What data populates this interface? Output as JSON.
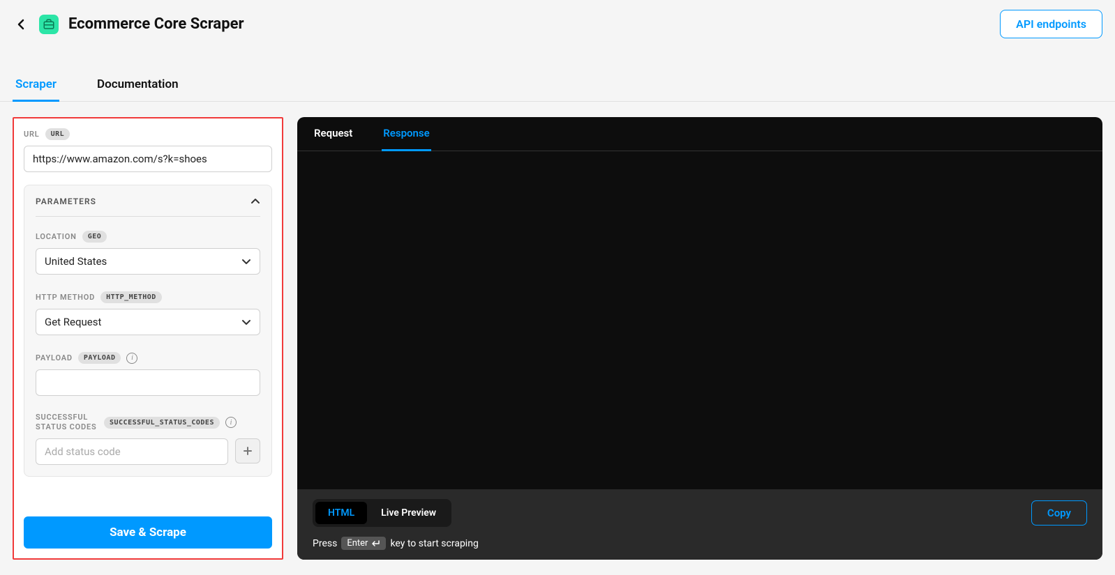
{
  "header": {
    "title": "Ecommerce Core Scraper",
    "api_endpoints": "API endpoints"
  },
  "tabs": {
    "scraper": "Scraper",
    "documentation": "Documentation"
  },
  "form": {
    "url": {
      "label": "URL",
      "badge": "URL",
      "value": "https://www.amazon.com/s?k=shoes"
    },
    "parameters_title": "PARAMETERS",
    "location": {
      "label": "LOCATION",
      "badge": "GEO",
      "value": "United States"
    },
    "http_method": {
      "label": "HTTP METHOD",
      "badge": "HTTP_METHOD",
      "value": "Get Request"
    },
    "payload": {
      "label": "PAYLOAD",
      "badge": "PAYLOAD",
      "value": ""
    },
    "status_codes": {
      "label": "SUCCESSFUL STATUS CODES",
      "badge": "SUCCESSFUL_STATUS_CODES",
      "placeholder": "Add status code"
    },
    "save_scrape": "Save & Scrape"
  },
  "right": {
    "tabs": {
      "request": "Request",
      "response": "Response"
    },
    "view": {
      "html": "HTML",
      "live": "Live Preview"
    },
    "copy": "Copy",
    "hint_press": "Press",
    "hint_enter": "Enter",
    "hint_rest": "key to start scraping"
  }
}
